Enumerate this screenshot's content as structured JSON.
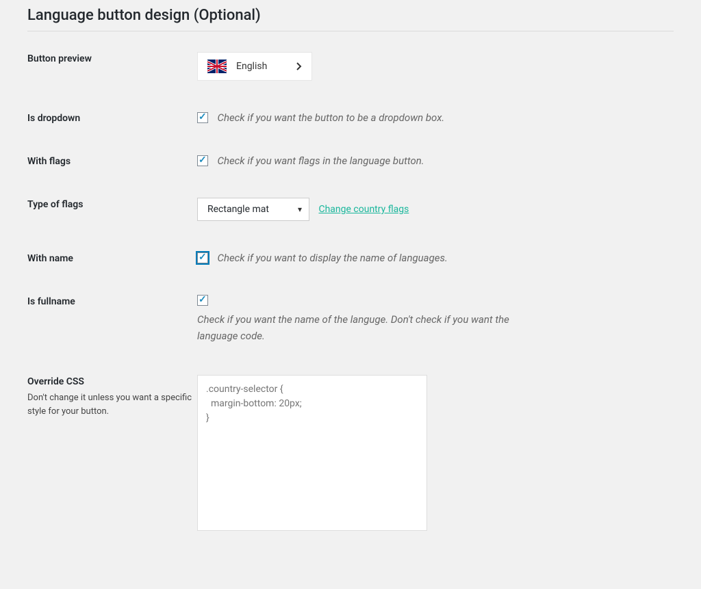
{
  "section_title": "Language button design (Optional)",
  "rows": {
    "preview": {
      "label": "Button preview",
      "lang_name": "English"
    },
    "is_dropdown": {
      "label": "Is dropdown",
      "hint": "Check if you want the button to be a dropdown box."
    },
    "with_flags": {
      "label": "With flags",
      "hint": "Check if you want flags in the language button."
    },
    "type_of_flags": {
      "label": "Type of flags",
      "selected": "Rectangle mat",
      "link": "Change country flags"
    },
    "with_name": {
      "label": "With name",
      "hint": "Check if you want to display the name of languages."
    },
    "is_fullname": {
      "label": "Is fullname",
      "hint": "Check if you want the name of the languge. Don't check if you want the language code."
    },
    "override_css": {
      "label": "Override CSS",
      "sub": "Don't change it unless you want a specific style for your button.",
      "placeholder": ".country-selector {\n  margin-bottom: 20px;\n}"
    }
  }
}
